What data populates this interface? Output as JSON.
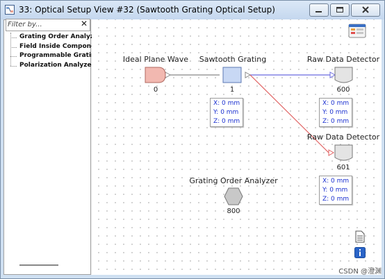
{
  "window": {
    "title": "33: Optical Setup View #32 (Sawtooth Grating Optical Setup)"
  },
  "sidebar": {
    "filter_placeholder": "Filter by...",
    "filter_clear": "✕",
    "items": [
      {
        "label": "Grating Order Analyzer"
      },
      {
        "label": "Field Inside Componer"
      },
      {
        "label": "Programmable Grating"
      },
      {
        "label": "Polarization Analyzer"
      }
    ]
  },
  "nodes": {
    "source": {
      "label": "Ideal Plane Wave",
      "number": "0",
      "color": "#f2b8b0"
    },
    "grating": {
      "label": "Sawtooth Grating",
      "number": "1",
      "color": "#c8d8f4",
      "coords": {
        "x": "X: 0 mm",
        "y": "Y: 0 mm",
        "z": "Z: 0 mm"
      }
    },
    "detector1": {
      "label": "Raw Data Detector",
      "number": "600",
      "coords": {
        "x": "X: 0 mm",
        "y": "Y: 0 mm",
        "z": "Z: 0 mm"
      }
    },
    "detector2": {
      "label": "Raw Data Detector",
      "number": "601",
      "coords": {
        "x": "X: 0 mm",
        "y": "Y: 0 mm",
        "z": "Z: 0 mm"
      }
    },
    "analyzer": {
      "label": "Grating Order Analyzer",
      "number": "800"
    }
  },
  "colors": {
    "wire_blue": "#6a6adf",
    "wire_red": "#e06060",
    "wire_gray": "#888888",
    "coord_text": "#1a2fd0"
  },
  "icons": {
    "toolbar_top": "table-settings-icon",
    "doc": "document-icon",
    "info": "info-icon"
  },
  "watermark": "CSDN @澄渊"
}
